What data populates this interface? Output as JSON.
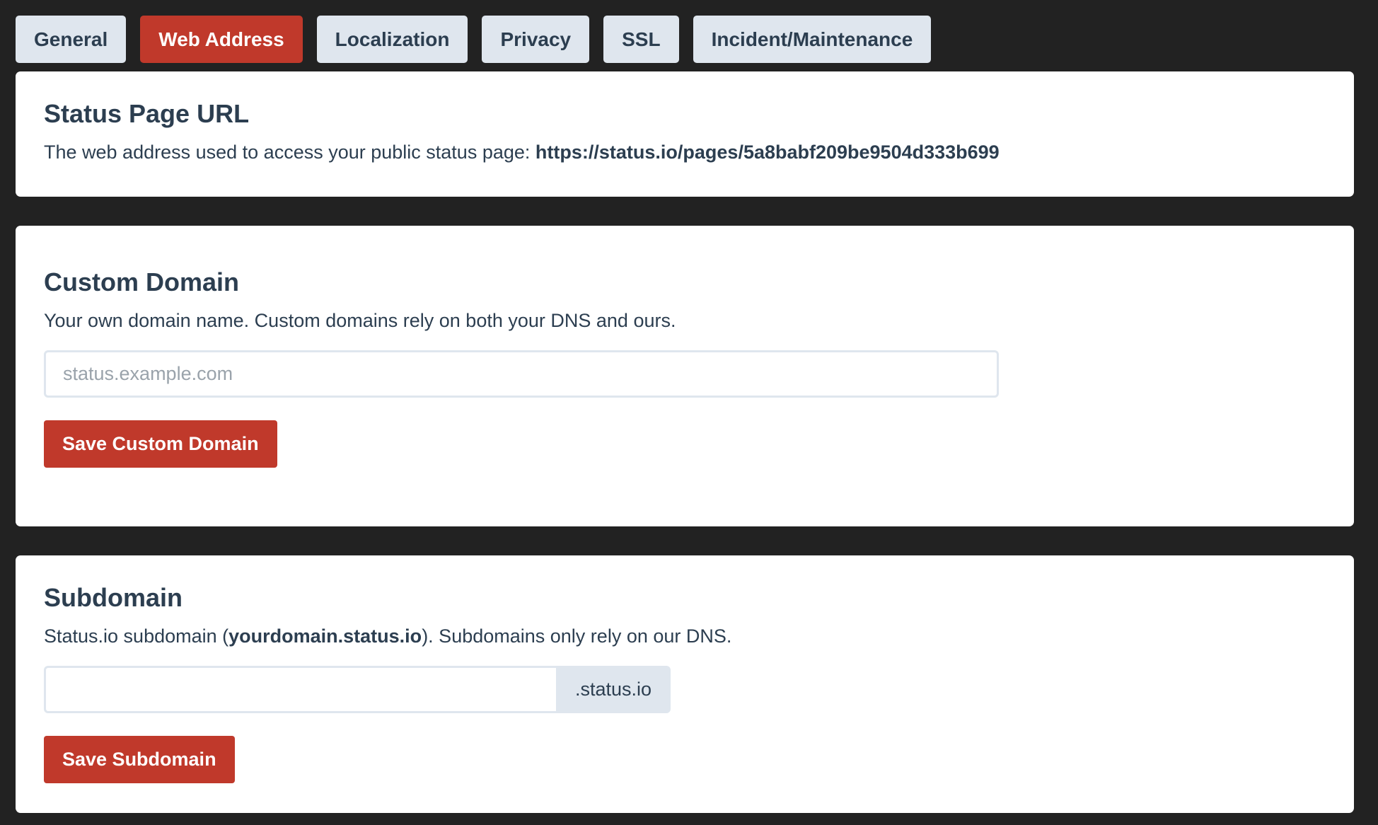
{
  "tabs": [
    {
      "label": "General",
      "active": false
    },
    {
      "label": "Web Address",
      "active": true
    },
    {
      "label": "Localization",
      "active": false
    },
    {
      "label": "Privacy",
      "active": false
    },
    {
      "label": "SSL",
      "active": false
    },
    {
      "label": "Incident/Maintenance",
      "active": false
    }
  ],
  "status_url": {
    "title": "Status Page URL",
    "desc_prefix": "The web address used to access your public status page: ",
    "url": "https://status.io/pages/5a8babf209be9504d333b699"
  },
  "custom_domain": {
    "title": "Custom Domain",
    "desc": "Your own domain name. Custom domains rely on both your DNS and ours.",
    "placeholder": "status.example.com",
    "value": "",
    "save_label": "Save Custom Domain"
  },
  "subdomain": {
    "title": "Subdomain",
    "desc_prefix": "Status.io subdomain (",
    "desc_bold": "yourdomain.status.io",
    "desc_suffix": "). Subdomains only rely on our DNS.",
    "value": "",
    "addon": ".status.io",
    "save_label": "Save Subdomain"
  },
  "colors": {
    "background": "#222222",
    "accent": "#c0392b",
    "tab_inactive": "#dfe6ee",
    "text": "#2c3e50"
  }
}
